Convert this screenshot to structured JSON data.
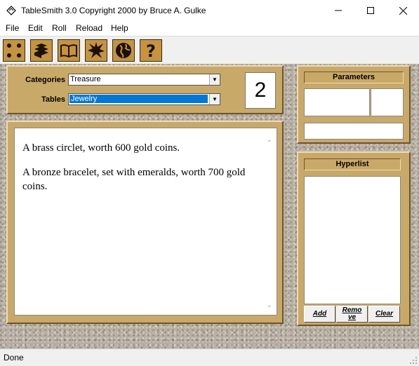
{
  "window": {
    "title": "TableSmith 3.0  Copyright 2000 by Bruce A. Gulke"
  },
  "menu": [
    "File",
    "Edit",
    "Roll",
    "Reload",
    "Help"
  ],
  "toolbar": {
    "buttons": [
      "dice-icon",
      "books-icon",
      "open-book-icon",
      "burst-icon",
      "globe-icon",
      "help-icon"
    ]
  },
  "selector": {
    "categories_label": "Categories",
    "categories_value": "Treasure",
    "tables_label": "Tables",
    "tables_value": "Jewelry",
    "roll_count": "2"
  },
  "results": {
    "lines": [
      "A brass circlet, worth 600 gold coins.",
      "A bronze bracelet, set with emeralds, worth 700 gold coins."
    ]
  },
  "parameters": {
    "title": "Parameters"
  },
  "hyperlist": {
    "title": "Hyperlist",
    "add_label": "Add",
    "remove_label": "Remove",
    "clear_label": "Clear"
  },
  "status": {
    "text": "Done"
  },
  "colors": {
    "panel": "#c9a968",
    "toolbar_button": "#c6933e",
    "selection": "#0078d7"
  }
}
